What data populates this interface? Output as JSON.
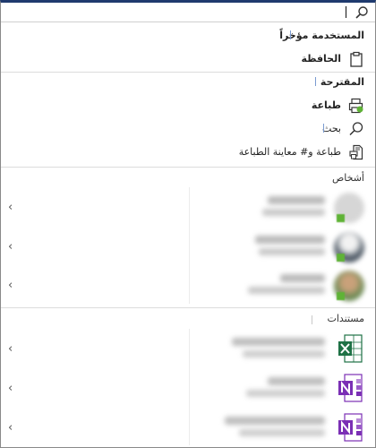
{
  "search": {
    "value": "",
    "icon": "search-icon"
  },
  "recent": {
    "heading": "المستخدمة مؤخراً",
    "items": [
      {
        "label": "الحافظة",
        "icon": "clipboard-icon"
      }
    ]
  },
  "suggested": {
    "heading": "المقترحة",
    "items": [
      {
        "label": "طباعة",
        "icon": "print-icon"
      },
      {
        "label": "بحث",
        "icon": "search-icon"
      },
      {
        "label": "طباعة و# معاينة الطباعة",
        "icon": "print-preview-icon"
      }
    ]
  },
  "people": {
    "heading": "أشخاص",
    "count": 3,
    "presence_color": "#5fb336"
  },
  "documents": {
    "heading": "مستندات",
    "items": [
      {
        "icon": "excel-icon",
        "color": "#1e7145"
      },
      {
        "icon": "onenote-icon",
        "color": "#7b2fb5"
      },
      {
        "icon": "onenote-icon",
        "color": "#7b2fb5"
      }
    ]
  },
  "colors": {
    "accent_bar": "#1f3a6e",
    "excel": "#1e7145",
    "onenote": "#7b2fb5"
  }
}
